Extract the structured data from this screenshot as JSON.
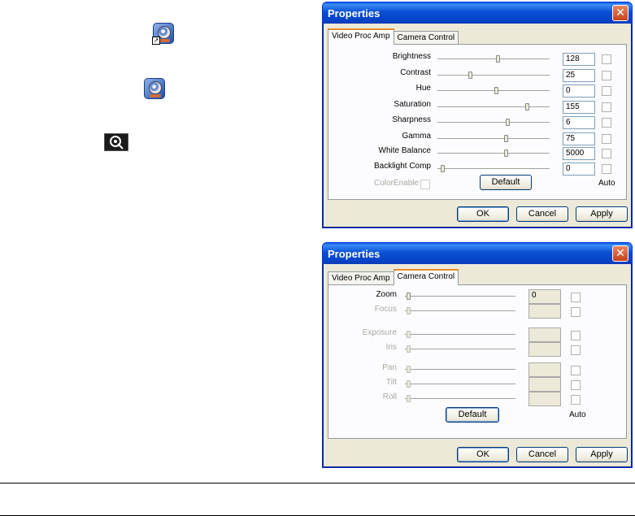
{
  "desktop": {
    "icons": [
      {
        "name": "webcam-shortcut-icon"
      },
      {
        "name": "webcam-app-icon"
      },
      {
        "name": "camera-settings-icon"
      }
    ]
  },
  "dialog1": {
    "title": "Properties",
    "close_glyph": "✕",
    "tabs": [
      {
        "label": "Video Proc Amp",
        "active": true
      },
      {
        "label": "Camera Control",
        "active": false
      }
    ],
    "rows": [
      {
        "label": "Brightness",
        "value": "128"
      },
      {
        "label": "Contrast",
        "value": "25"
      },
      {
        "label": "Hue",
        "value": "0"
      },
      {
        "label": "Saturation",
        "value": "155"
      },
      {
        "label": "Sharpness",
        "value": "6"
      },
      {
        "label": "Gamma",
        "value": "75"
      },
      {
        "label": "White Balance",
        "value": "5000"
      },
      {
        "label": "Backlight Comp",
        "value": "0"
      }
    ],
    "color_enable_label": "ColorEnable",
    "default_label": "Default",
    "auto_label": "Auto",
    "ok_label": "OK",
    "cancel_label": "Cancel",
    "apply_label": "Apply"
  },
  "dialog2": {
    "title": "Properties",
    "close_glyph": "✕",
    "tabs": [
      {
        "label": "Video Proc Amp",
        "active": false
      },
      {
        "label": "Camera Control",
        "active": true
      }
    ],
    "rows": [
      {
        "label": "Zoom",
        "value": "0",
        "enabled": true
      },
      {
        "label": "Focus",
        "value": "",
        "enabled": false
      },
      {
        "label": "Exposure",
        "value": "",
        "enabled": false
      },
      {
        "label": "Iris",
        "value": "",
        "enabled": false
      },
      {
        "label": "Pan",
        "value": "",
        "enabled": false
      },
      {
        "label": "Tilt",
        "value": "",
        "enabled": false
      },
      {
        "label": "Roll",
        "value": "",
        "enabled": false
      }
    ],
    "default_label": "Default",
    "auto_label": "Auto",
    "ok_label": "OK",
    "cancel_label": "Cancel",
    "apply_label": "Apply"
  }
}
